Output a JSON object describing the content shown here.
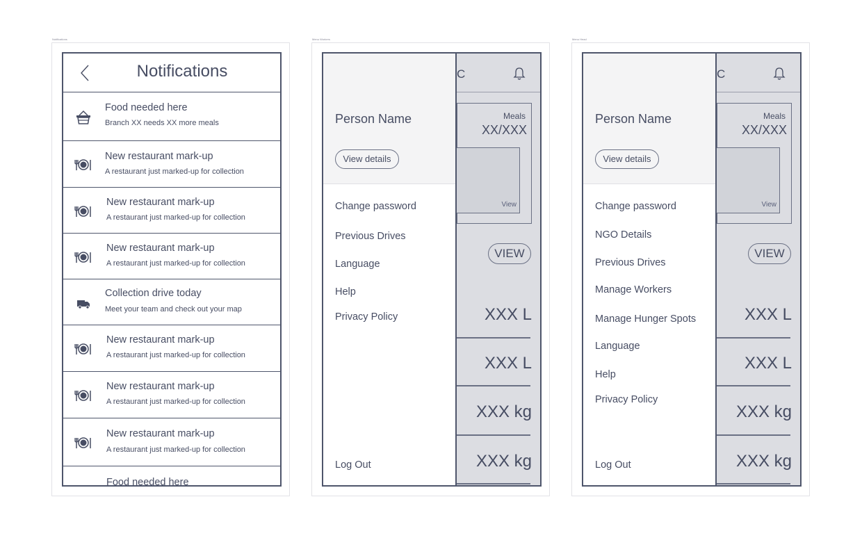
{
  "frames": [
    {
      "label": "Notifications"
    },
    {
      "label": "Menu Workers"
    },
    {
      "label": "Menu Head"
    }
  ],
  "notifications": {
    "title": "Notifications",
    "items": [
      {
        "icon": "basket-icon",
        "title": "Food needed here",
        "subtitle": "Branch XX needs XX more meals"
      },
      {
        "icon": "plate-cutlery-icon",
        "title": "New restaurant mark-up",
        "subtitle": "A restaurant just marked-up for collection"
      },
      {
        "icon": "plate-cutlery-icon",
        "title": "New restaurant mark-up",
        "subtitle": "A restaurant just marked-up for collection"
      },
      {
        "icon": "plate-cutlery-icon",
        "title": "New restaurant mark-up",
        "subtitle": "A restaurant just marked-up for collection"
      },
      {
        "icon": "truck-icon",
        "title": "Collection drive today",
        "subtitle": "Meet your team and check out your map"
      },
      {
        "icon": "plate-cutlery-icon",
        "title": "New restaurant mark-up",
        "subtitle": "A restaurant just marked-up for collection"
      },
      {
        "icon": "plate-cutlery-icon",
        "title": "New restaurant mark-up",
        "subtitle": "A restaurant just marked-up for collection"
      },
      {
        "icon": "plate-cutlery-icon",
        "title": "New restaurant mark-up",
        "subtitle": "A restaurant just marked-up for collection"
      },
      {
        "icon": "basket-icon",
        "title": "Food needed here",
        "subtitle": ""
      }
    ]
  },
  "menus": [
    {
      "person_name": "Person Name",
      "view_details": "View details",
      "items": [
        "Change password",
        "Previous Drives",
        "Language",
        "Help",
        "Privacy Policy"
      ],
      "logout": "Log Out",
      "background": {
        "top_letter": "C",
        "meals_label": "Meals",
        "meals_value": "XX/XXX",
        "image_view": "View",
        "view_button": "VIEW",
        "stats": [
          "XXX L",
          "XXX L",
          "XXX kg",
          "XXX kg"
        ]
      }
    },
    {
      "person_name": "Person Name",
      "view_details": "View details",
      "items": [
        "Change password",
        "NGO Details",
        "Previous Drives",
        "Manage Workers",
        "Manage Hunger Spots",
        "Language",
        "Help",
        "Privacy Policy"
      ],
      "logout": "Log Out",
      "background": {
        "top_letter": "C",
        "meals_label": "Meals",
        "meals_value": "XX/XXX",
        "image_view": "View",
        "view_button": "VIEW",
        "stats": [
          "XXX L",
          "XXX L",
          "XXX kg",
          "XXX kg"
        ]
      }
    }
  ]
}
